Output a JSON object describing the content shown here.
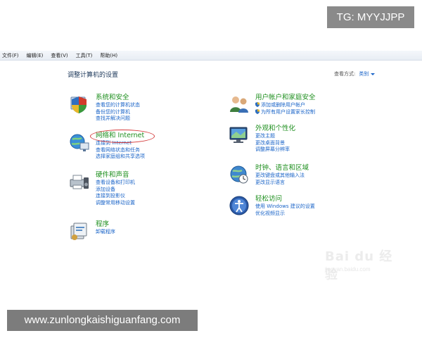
{
  "overlay_tag": "TG: MYYJJPP",
  "menu": [
    "文件(F)",
    "编辑(E)",
    "查看(V)",
    "工具(T)",
    "帮助(H)"
  ],
  "page_title": "调整计算机的设置",
  "view_by": {
    "label": "查看方式:",
    "value": "类别"
  },
  "left_categories": [
    {
      "title": "系统和安全",
      "icon": "shield-pc-icon",
      "links": [
        "查看您的计算机状态",
        "备份您的计算机",
        "查找并解决问题"
      ]
    },
    {
      "title": "网络和 Internet",
      "icon": "network-globe-icon",
      "links": [
        "连接到 Internet",
        "查看网络状态和任务",
        "选择家庭组和共享选项"
      ]
    },
    {
      "title": "硬件和声音",
      "icon": "printer-speaker-icon",
      "links": [
        "查看设备和打印机",
        "添加设备",
        "连接到投影仪",
        "调整常用移动设置"
      ]
    },
    {
      "title": "程序",
      "icon": "programs-icon",
      "links": [
        "卸载程序"
      ]
    }
  ],
  "right_categories": [
    {
      "title": "用户帐户和家庭安全",
      "icon": "users-icon",
      "links": [
        "添加或删除用户帐户",
        "为所有用户设置家长控制"
      ],
      "shield_links": true
    },
    {
      "title": "外观和个性化",
      "icon": "monitor-icon",
      "links": [
        "更改主题",
        "更改桌面背景",
        "调整屏幕分辨率"
      ]
    },
    {
      "title": "时钟、语言和区域",
      "icon": "clock-globe-icon",
      "links": [
        "更改键盘或其他输入法",
        "更改显示语言"
      ]
    },
    {
      "title": "轻松访问",
      "icon": "ease-of-access-icon",
      "links": [
        "使用 Windows 建议的设置",
        "优化视频显示"
      ]
    }
  ],
  "watermark": {
    "logo": "Bai du 经验",
    "url": "jingyan.baidu.com"
  },
  "bottom_banner": "www.zunlongkaishiguanfang.com",
  "colors": {
    "category_title": "#1e8f1e",
    "link": "#1a64c8",
    "annotation": "#d43c3c"
  }
}
